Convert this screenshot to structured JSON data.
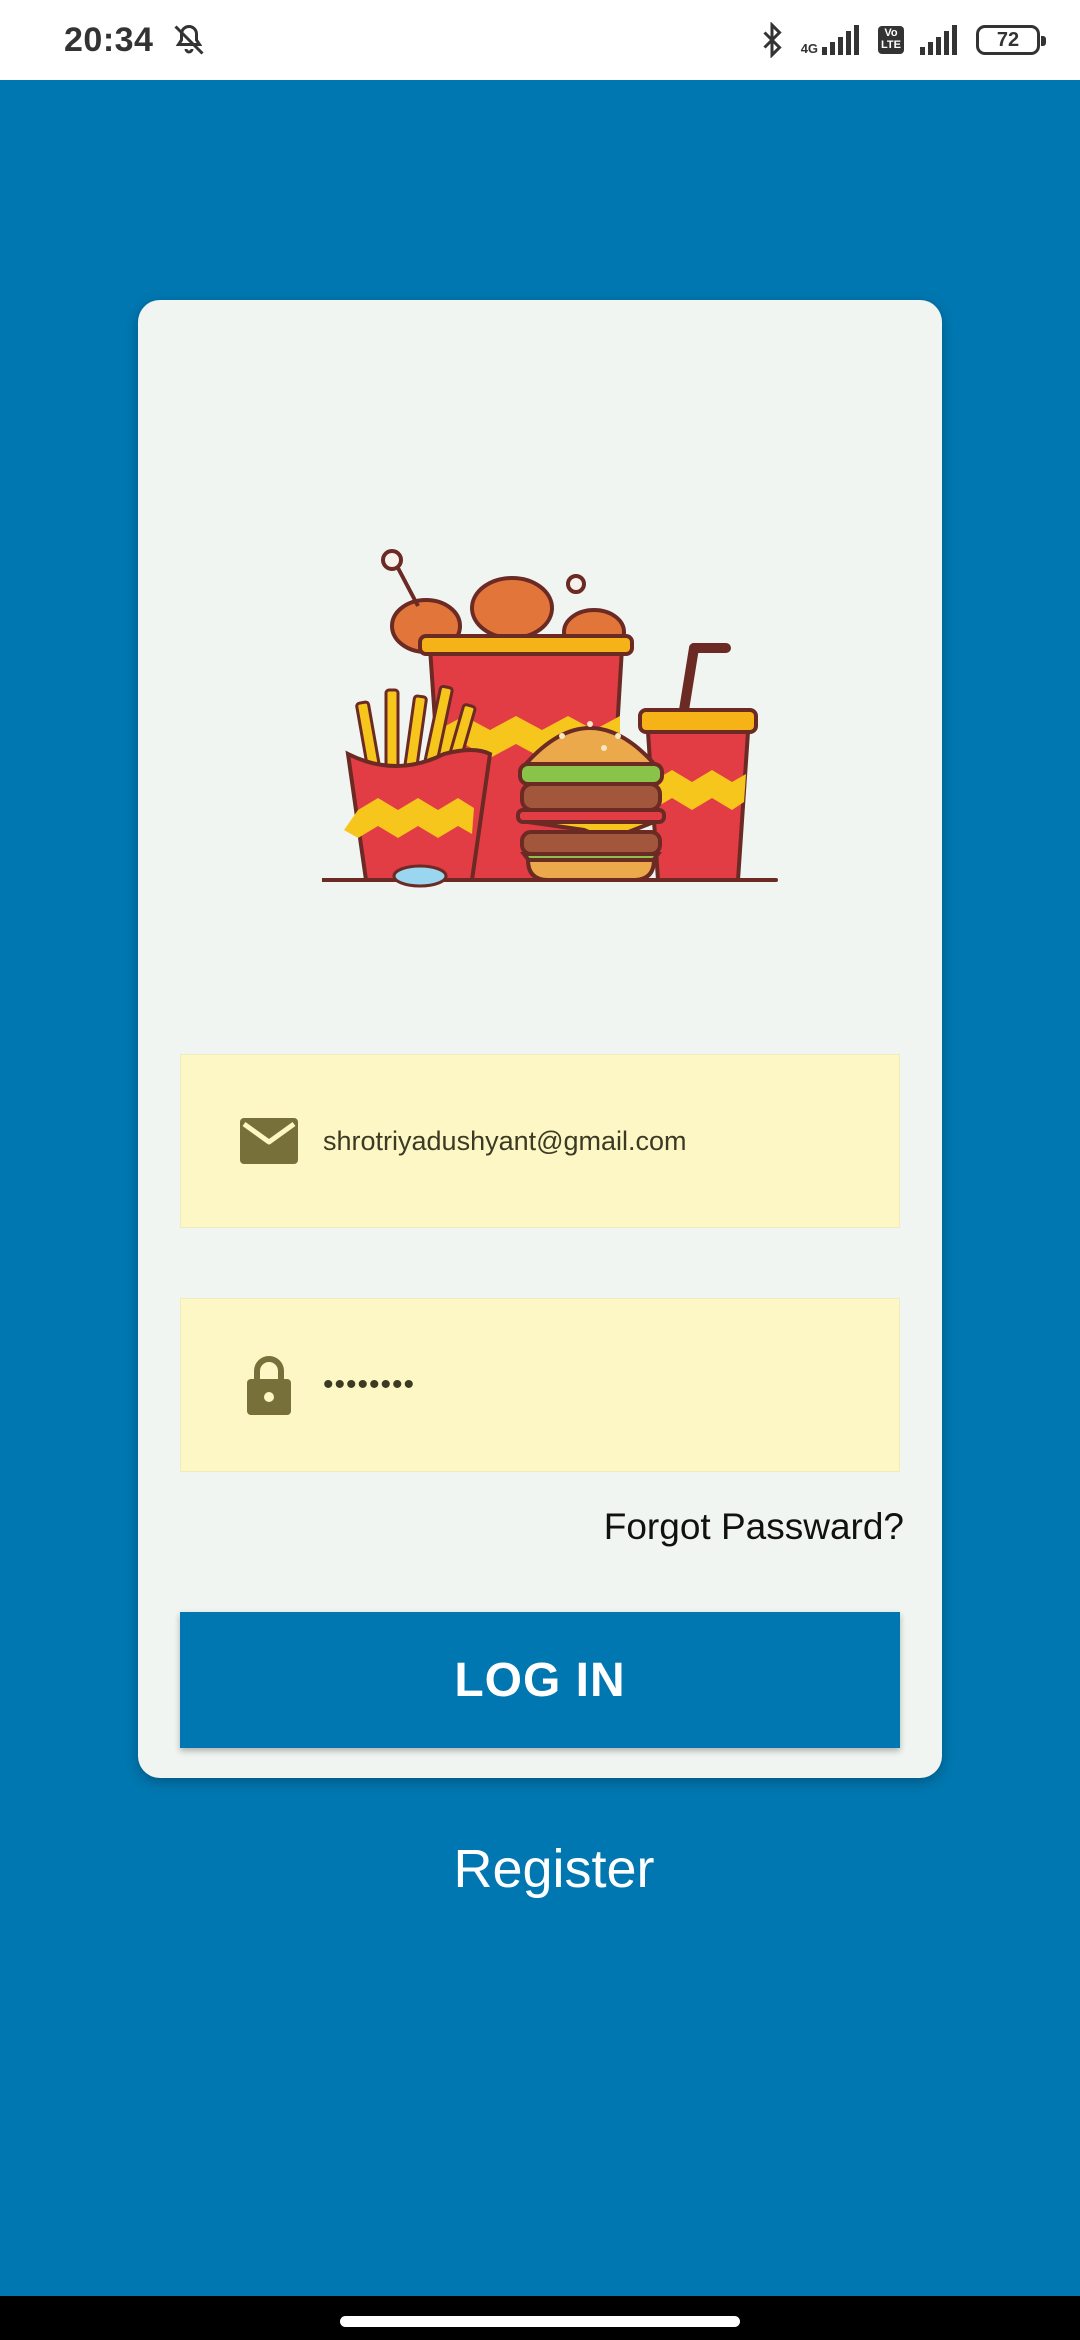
{
  "status_bar": {
    "time": "20:34",
    "network_type": "4G",
    "volte_label": "Vo\nLTE",
    "battery_level": "72",
    "icons": [
      "mute-notifications-icon",
      "bluetooth-icon",
      "signal-icon",
      "volte-icon",
      "signal-icon",
      "battery-icon"
    ]
  },
  "login": {
    "email_value": "shrotriyadushyant@gmail.com",
    "password_value": "••••••••",
    "forgot_password_label": "Forgot Passward?",
    "login_button_label": "LOG IN",
    "register_label": "Register"
  },
  "colors": {
    "background": "#0077b0",
    "card": "#f1f5f2",
    "input_fill": "#fcf7c4",
    "icon_olive": "#77703a",
    "button": "#0077b0"
  }
}
